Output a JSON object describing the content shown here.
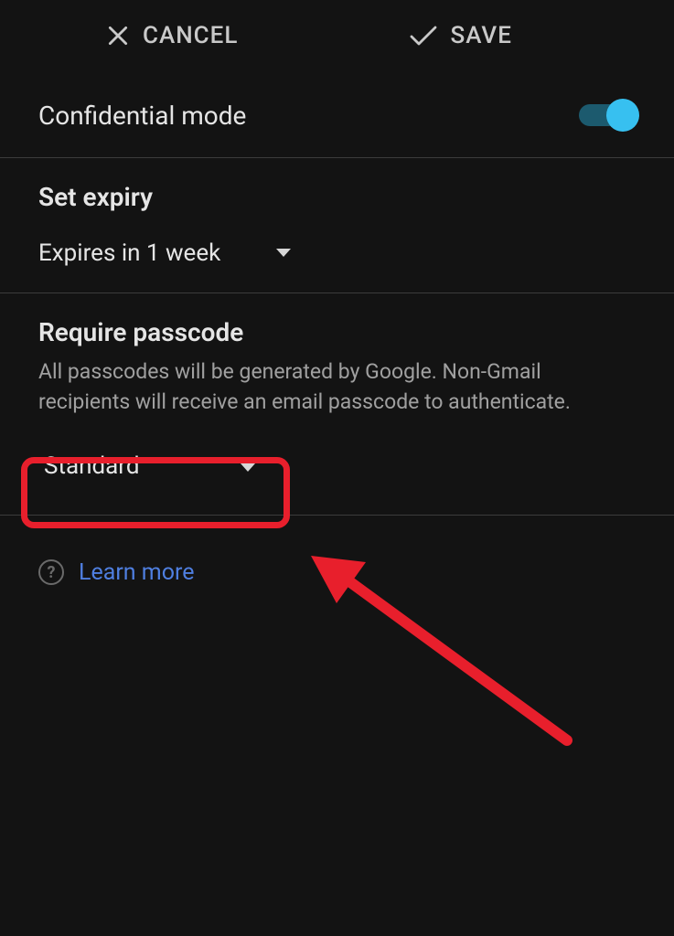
{
  "header": {
    "cancel_label": "CANCEL",
    "save_label": "SAVE"
  },
  "confidential": {
    "title": "Confidential mode",
    "enabled": true
  },
  "expiry": {
    "title": "Set expiry",
    "value": "Expires in 1 week"
  },
  "passcode": {
    "title": "Require passcode",
    "subtext": "All passcodes will be generated by Google. Non-Gmail recipients will receive an email passcode to authenticate.",
    "value": "Standard"
  },
  "learn_more": {
    "label": "Learn more"
  }
}
